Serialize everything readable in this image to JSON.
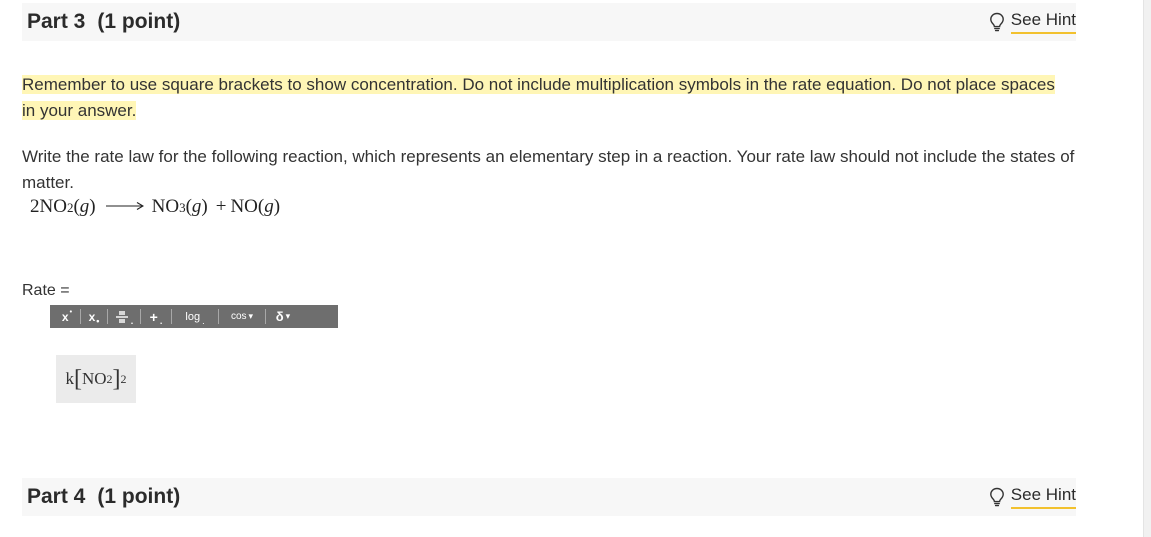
{
  "part3": {
    "title": "Part 3",
    "points": "(1 point)",
    "hint_label": "See Hint"
  },
  "note": "Remember to use square brackets to show concentration. Do not include multiplication symbols in the rate equation. Do not place spaces in your answer.",
  "question": "Write the rate law for the following reaction, which represents an elementary step in a reaction. Your rate law should not include the states of matter.",
  "equation": {
    "coef": "2",
    "reactant": "NO",
    "reactant_sub": "2",
    "product1": "NO",
    "product1_sub": "3",
    "plus": "+",
    "product2": "NO",
    "state": "g"
  },
  "rate_label": "Rate =",
  "toolbar": {
    "superscript": "x",
    "subscript": "x",
    "plus": "+",
    "log": "log",
    "cos": "cos",
    "delta": "δ",
    "dot": "."
  },
  "answer": {
    "k": "k",
    "open": "[",
    "species": "NO",
    "species_sub": "2",
    "close": "]",
    "power": "2"
  },
  "part4": {
    "title": "Part 4",
    "points": "(1 point)",
    "hint_label": "See Hint"
  },
  "colors": {
    "highlight": "#fff6b6",
    "hint_underline": "#f2c12e",
    "toolbar_bg": "#6e6e6e",
    "header_bg": "#f7f7f7"
  },
  "icons": {
    "hint": "lightbulb-icon"
  }
}
